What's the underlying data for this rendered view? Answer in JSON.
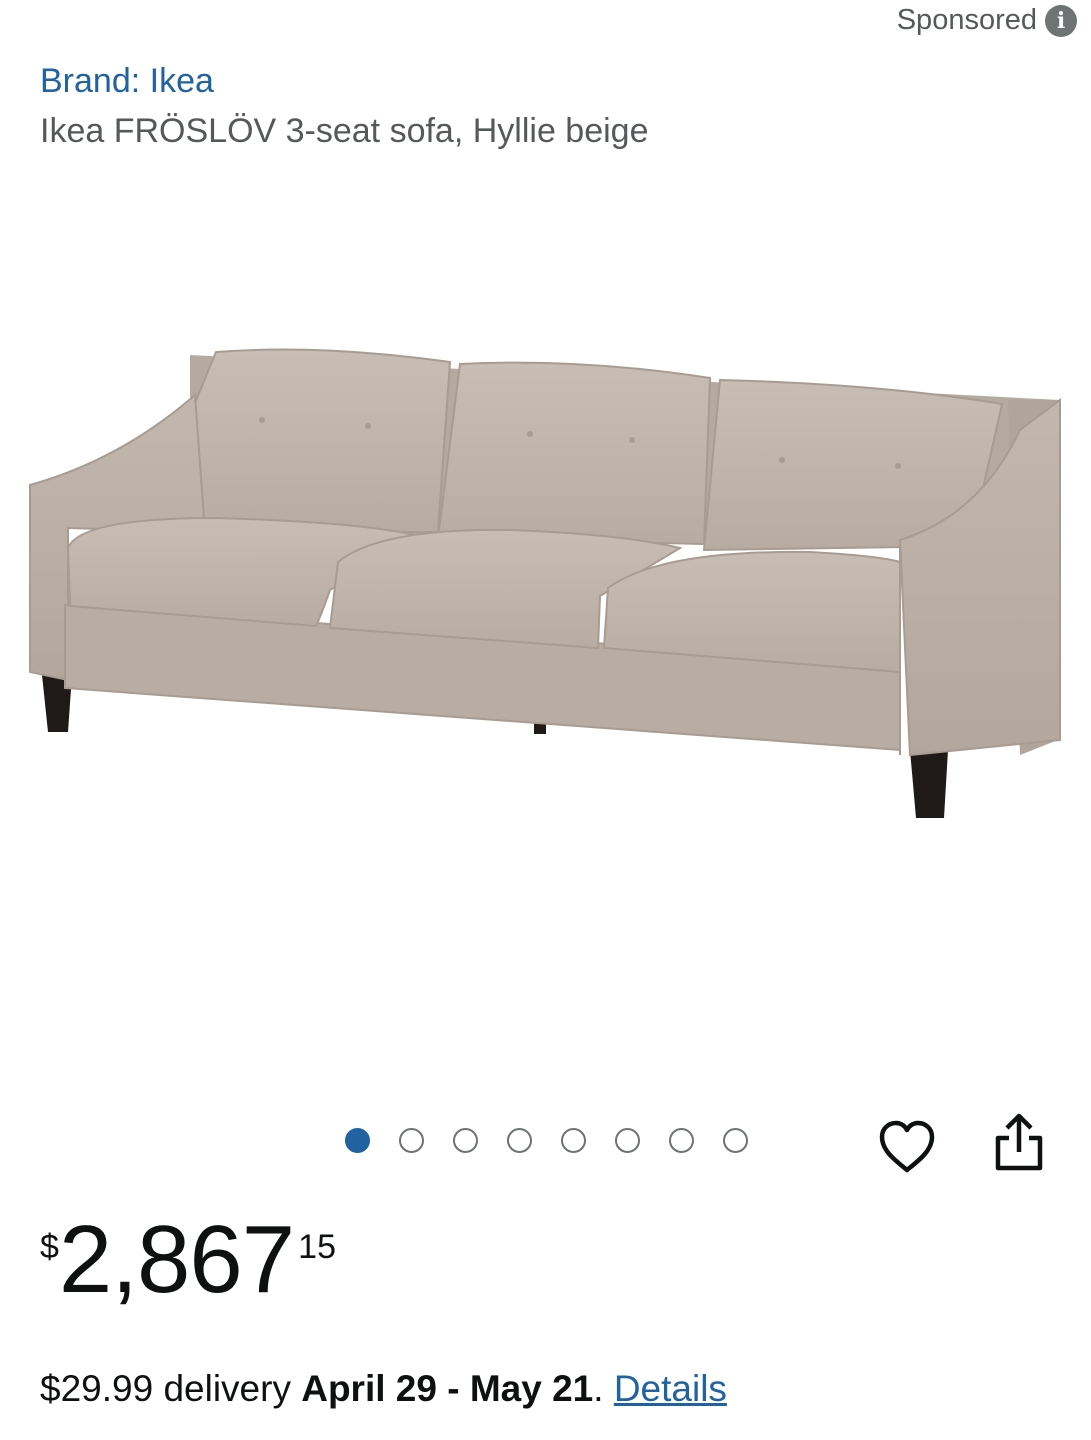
{
  "sponsored": {
    "label": "Sponsored",
    "icon": "info-icon"
  },
  "product": {
    "brand": "Brand: Ikea",
    "title": "Ikea FRÖSLÖV 3-seat sofa, Hyllie beige",
    "image_count": 8,
    "active_image": 1
  },
  "actions": {
    "wishlist_icon": "heart-icon",
    "share_icon": "share-icon"
  },
  "price": {
    "symbol": "$",
    "whole": "2,867",
    "fraction": "15"
  },
  "delivery": {
    "cost": "$29.99 delivery",
    "dates": "April 29 - May 21",
    "period": ".",
    "details_link": "Details"
  },
  "colors": {
    "link": "#2162a1",
    "active_dot": "#2162a1",
    "text": "#0f1111",
    "muted": "#565959"
  }
}
